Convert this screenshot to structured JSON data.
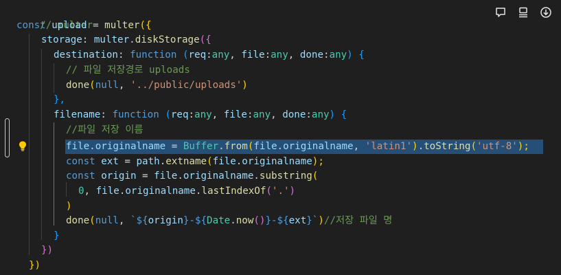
{
  "code": {
    "l1": "// multer",
    "l2": [
      "const",
      "upload",
      "=",
      "multer",
      "({"
    ],
    "l3": [
      "storage",
      ":",
      "multer",
      ".",
      "diskStorage",
      "({"
    ],
    "l4": [
      "destination",
      ":",
      "function",
      "(",
      "req",
      ":",
      "any",
      ", ",
      "file",
      ":",
      "any",
      ", ",
      "done",
      ":",
      "any",
      ")",
      "{"
    ],
    "l5": "// 파일 저장경로 uploads",
    "l6": [
      "done",
      "(",
      "null",
      ", ",
      "'../public/uploads'",
      ")"
    ],
    "l7": "},",
    "l8": [
      "filename",
      ":",
      "function",
      "(",
      "req",
      ":",
      "any",
      ", ",
      "file",
      ":",
      "any",
      ", ",
      "done",
      ":",
      "any",
      ")",
      "{"
    ],
    "l9": "//파일 저장 이름",
    "l10": [
      "file",
      ".",
      "originalname",
      " = ",
      "Buffer",
      ".",
      "from",
      "(",
      "file",
      ".",
      "originalname",
      ", ",
      "'latin1'",
      ")",
      ".",
      "toString",
      "(",
      "'utf-8'",
      ");"
    ],
    "l11": [
      "const",
      "ext",
      " = ",
      "path",
      ".",
      "extname",
      "(",
      "file",
      ".",
      "originalname",
      ");"
    ],
    "l12": [
      "const",
      "origin",
      " = ",
      "file",
      ".",
      "originalname",
      ".",
      "substring",
      "("
    ],
    "l13": [
      "0",
      ", ",
      "file",
      ".",
      "originalname",
      ".",
      "lastIndexOf",
      "(",
      "'.'",
      ")"
    ],
    "l14": ")",
    "l15": [
      "done",
      "(",
      "null",
      ", ",
      "`${",
      "origin",
      "}-${",
      "Date",
      ".",
      "now",
      "()",
      "}-${",
      "ext",
      "}`",
      ")",
      "//저장 파일 명"
    ],
    "l16": "}",
    "l17": "})",
    "l18": "})"
  },
  "toolbar": {
    "icons": [
      "comment-icon",
      "list-icon",
      "download-icon"
    ]
  },
  "colors": {
    "background": "#1f1f1f",
    "selection": "#264f78",
    "comment": "#6a9955",
    "keyword": "#569cd6",
    "variable": "#9cdcfe",
    "function": "#dcdcaa",
    "string": "#ce9178",
    "bracket1": "#ffd700",
    "bracket2": "#da70d6",
    "bracket3": "#179fff"
  }
}
